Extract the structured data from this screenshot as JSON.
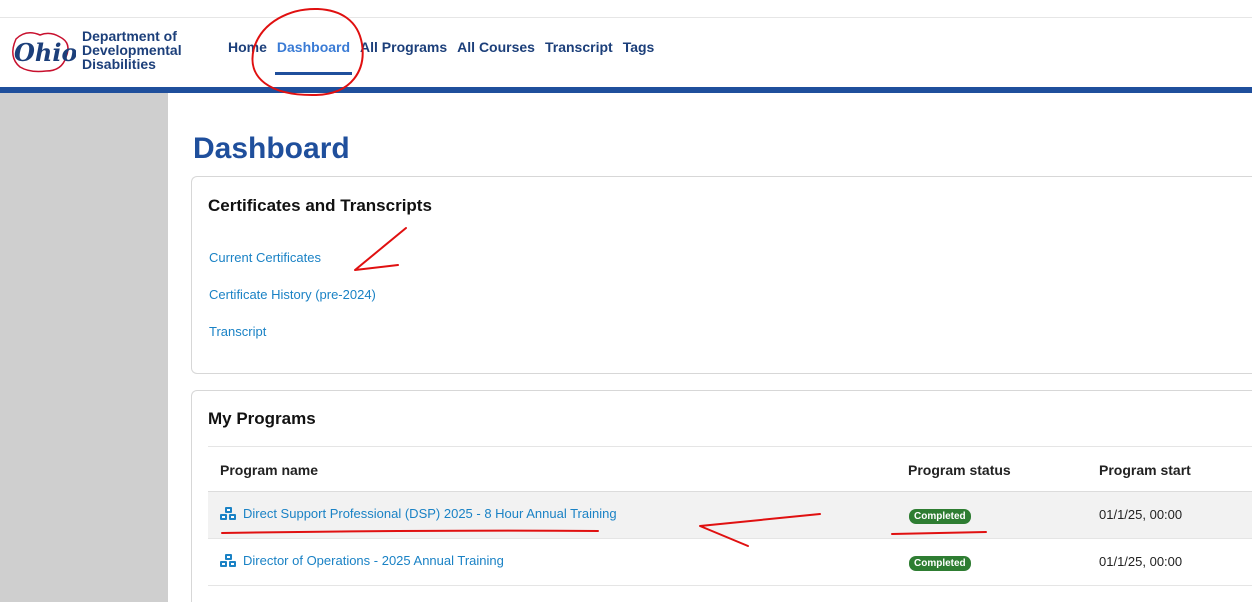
{
  "header": {
    "agency_line1": "Department of",
    "agency_line2": "Developmental",
    "agency_line3": "Disabilities",
    "logo_text": "Ohio"
  },
  "nav": {
    "items": [
      {
        "label": "Home",
        "active": false
      },
      {
        "label": "Dashboard",
        "active": true
      },
      {
        "label": "All Programs",
        "active": false
      },
      {
        "label": "All Courses",
        "active": false
      },
      {
        "label": "Transcript",
        "active": false
      },
      {
        "label": "Tags",
        "active": false
      }
    ]
  },
  "page": {
    "title": "Dashboard"
  },
  "certificates": {
    "heading": "Certificates and Transcripts",
    "links": [
      "Current Certificates",
      "Certificate History (pre-2024)",
      "Transcript"
    ]
  },
  "programs": {
    "heading": "My Programs",
    "columns": [
      "Program name",
      "Program status",
      "Program start"
    ],
    "rows": [
      {
        "name": "Direct Support Professional (DSP) 2025 - 8 Hour Annual Training",
        "status": "Completed",
        "start": "01/1/25, 00:00"
      },
      {
        "name": "Director of Operations - 2025 Annual Training",
        "status": "Completed",
        "start": "01/1/25, 00:00"
      }
    ]
  },
  "colors": {
    "brand_blue": "#1f4f9c",
    "link_blue": "#1a82c5",
    "status_green": "#2e7d32",
    "annotation_red": "#e01010"
  },
  "icons": {
    "program_icon": "cubes-icon"
  }
}
